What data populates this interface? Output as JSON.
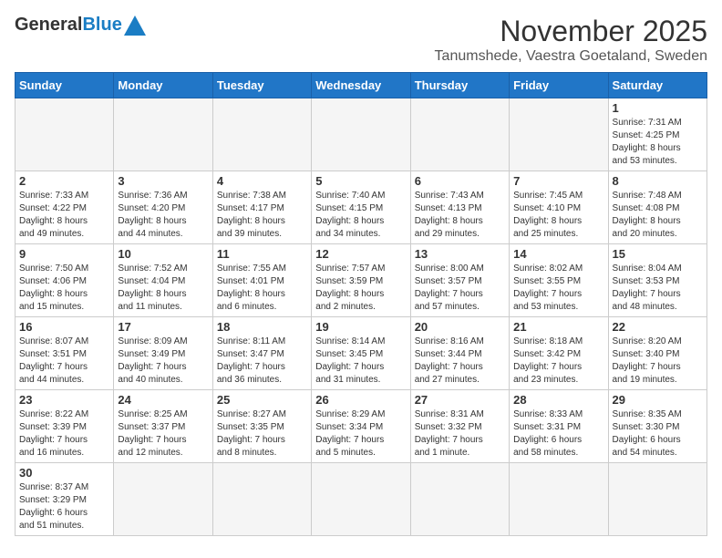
{
  "logo": {
    "general": "General",
    "blue": "Blue"
  },
  "title": {
    "month": "November 2025",
    "location": "Tanumshede, Vaestra Goetaland, Sweden"
  },
  "headers": [
    "Sunday",
    "Monday",
    "Tuesday",
    "Wednesday",
    "Thursday",
    "Friday",
    "Saturday"
  ],
  "days": [
    {
      "num": "",
      "info": ""
    },
    {
      "num": "",
      "info": ""
    },
    {
      "num": "",
      "info": ""
    },
    {
      "num": "",
      "info": ""
    },
    {
      "num": "",
      "info": ""
    },
    {
      "num": "",
      "info": ""
    },
    {
      "num": "1",
      "info": "Sunrise: 7:31 AM\nSunset: 4:25 PM\nDaylight: 8 hours\nand 53 minutes."
    },
    {
      "num": "2",
      "info": "Sunrise: 7:33 AM\nSunset: 4:22 PM\nDaylight: 8 hours\nand 49 minutes."
    },
    {
      "num": "3",
      "info": "Sunrise: 7:36 AM\nSunset: 4:20 PM\nDaylight: 8 hours\nand 44 minutes."
    },
    {
      "num": "4",
      "info": "Sunrise: 7:38 AM\nSunset: 4:17 PM\nDaylight: 8 hours\nand 39 minutes."
    },
    {
      "num": "5",
      "info": "Sunrise: 7:40 AM\nSunset: 4:15 PM\nDaylight: 8 hours\nand 34 minutes."
    },
    {
      "num": "6",
      "info": "Sunrise: 7:43 AM\nSunset: 4:13 PM\nDaylight: 8 hours\nand 29 minutes."
    },
    {
      "num": "7",
      "info": "Sunrise: 7:45 AM\nSunset: 4:10 PM\nDaylight: 8 hours\nand 25 minutes."
    },
    {
      "num": "8",
      "info": "Sunrise: 7:48 AM\nSunset: 4:08 PM\nDaylight: 8 hours\nand 20 minutes."
    },
    {
      "num": "9",
      "info": "Sunrise: 7:50 AM\nSunset: 4:06 PM\nDaylight: 8 hours\nand 15 minutes."
    },
    {
      "num": "10",
      "info": "Sunrise: 7:52 AM\nSunset: 4:04 PM\nDaylight: 8 hours\nand 11 minutes."
    },
    {
      "num": "11",
      "info": "Sunrise: 7:55 AM\nSunset: 4:01 PM\nDaylight: 8 hours\nand 6 minutes."
    },
    {
      "num": "12",
      "info": "Sunrise: 7:57 AM\nSunset: 3:59 PM\nDaylight: 8 hours\nand 2 minutes."
    },
    {
      "num": "13",
      "info": "Sunrise: 8:00 AM\nSunset: 3:57 PM\nDaylight: 7 hours\nand 57 minutes."
    },
    {
      "num": "14",
      "info": "Sunrise: 8:02 AM\nSunset: 3:55 PM\nDaylight: 7 hours\nand 53 minutes."
    },
    {
      "num": "15",
      "info": "Sunrise: 8:04 AM\nSunset: 3:53 PM\nDaylight: 7 hours\nand 48 minutes."
    },
    {
      "num": "16",
      "info": "Sunrise: 8:07 AM\nSunset: 3:51 PM\nDaylight: 7 hours\nand 44 minutes."
    },
    {
      "num": "17",
      "info": "Sunrise: 8:09 AM\nSunset: 3:49 PM\nDaylight: 7 hours\nand 40 minutes."
    },
    {
      "num": "18",
      "info": "Sunrise: 8:11 AM\nSunset: 3:47 PM\nDaylight: 7 hours\nand 36 minutes."
    },
    {
      "num": "19",
      "info": "Sunrise: 8:14 AM\nSunset: 3:45 PM\nDaylight: 7 hours\nand 31 minutes."
    },
    {
      "num": "20",
      "info": "Sunrise: 8:16 AM\nSunset: 3:44 PM\nDaylight: 7 hours\nand 27 minutes."
    },
    {
      "num": "21",
      "info": "Sunrise: 8:18 AM\nSunset: 3:42 PM\nDaylight: 7 hours\nand 23 minutes."
    },
    {
      "num": "22",
      "info": "Sunrise: 8:20 AM\nSunset: 3:40 PM\nDaylight: 7 hours\nand 19 minutes."
    },
    {
      "num": "23",
      "info": "Sunrise: 8:22 AM\nSunset: 3:39 PM\nDaylight: 7 hours\nand 16 minutes."
    },
    {
      "num": "24",
      "info": "Sunrise: 8:25 AM\nSunset: 3:37 PM\nDaylight: 7 hours\nand 12 minutes."
    },
    {
      "num": "25",
      "info": "Sunrise: 8:27 AM\nSunset: 3:35 PM\nDaylight: 7 hours\nand 8 minutes."
    },
    {
      "num": "26",
      "info": "Sunrise: 8:29 AM\nSunset: 3:34 PM\nDaylight: 7 hours\nand 5 minutes."
    },
    {
      "num": "27",
      "info": "Sunrise: 8:31 AM\nSunset: 3:32 PM\nDaylight: 7 hours\nand 1 minute."
    },
    {
      "num": "28",
      "info": "Sunrise: 8:33 AM\nSunset: 3:31 PM\nDaylight: 6 hours\nand 58 minutes."
    },
    {
      "num": "29",
      "info": "Sunrise: 8:35 AM\nSunset: 3:30 PM\nDaylight: 6 hours\nand 54 minutes."
    },
    {
      "num": "30",
      "info": "Sunrise: 8:37 AM\nSunset: 3:29 PM\nDaylight: 6 hours\nand 51 minutes."
    },
    {
      "num": "",
      "info": ""
    },
    {
      "num": "",
      "info": ""
    },
    {
      "num": "",
      "info": ""
    },
    {
      "num": "",
      "info": ""
    },
    {
      "num": "",
      "info": ""
    },
    {
      "num": "",
      "info": ""
    }
  ]
}
